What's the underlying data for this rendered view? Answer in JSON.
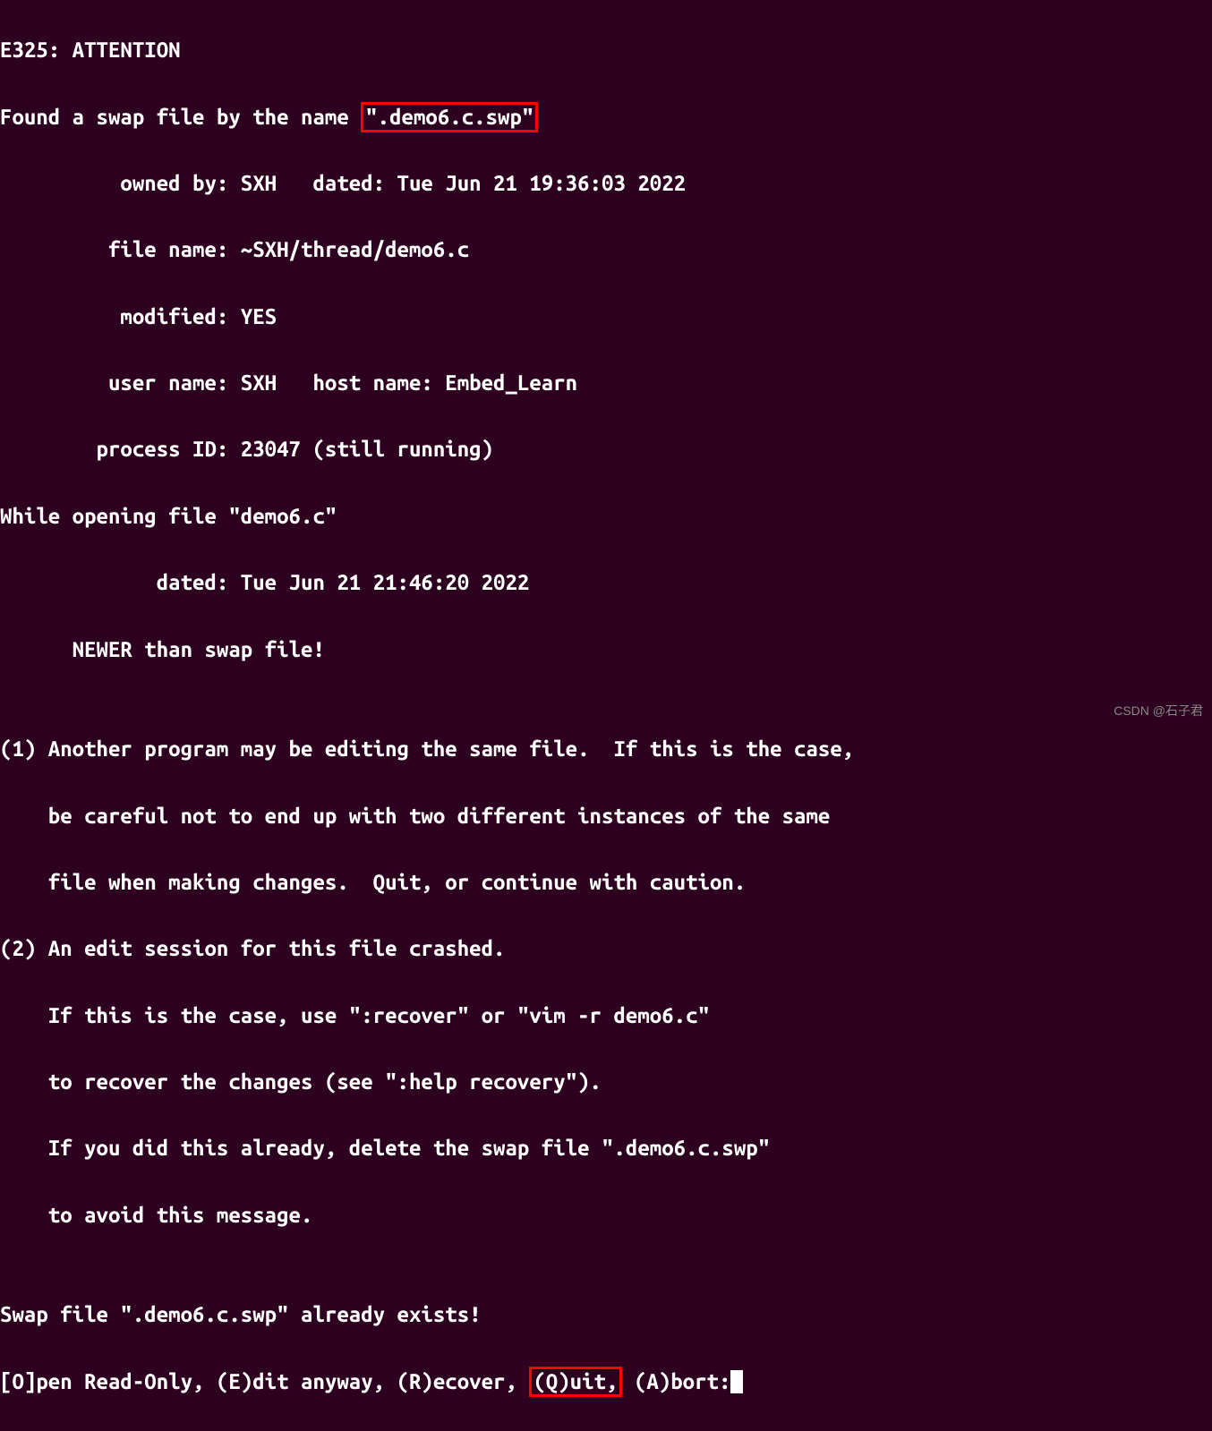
{
  "lines": {
    "l1": "E325: ATTENTION",
    "l2_pre": "Found a swap file by the name ",
    "l2_hl": "\".demo6.c.swp\"",
    "l3": "          owned by: SXH   dated: Tue Jun 21 19:36:03 2022",
    "l4": "         file name: ~SXH/thread/demo6.c",
    "l5": "          modified: YES",
    "l6": "         user name: SXH   host name: Embed_Learn",
    "l7": "        process ID: 23047 (still running)",
    "l8": "While opening file \"demo6.c\"",
    "l9": "             dated: Tue Jun 21 21:46:20 2022",
    "l10": "      NEWER than swap file!",
    "l11": "",
    "l12": "(1) Another program may be editing the same file.  If this is the case,",
    "l13": "    be careful not to end up with two different instances of the same",
    "l14": "    file when making changes.  Quit, or continue with caution.",
    "l15": "(2) An edit session for this file crashed.",
    "l16": "    If this is the case, use \":recover\" or \"vim -r demo6.c\"",
    "l17": "    to recover the changes (see \":help recovery\").",
    "l18": "    If you did this already, delete the swap file \".demo6.c.swp\"",
    "l19": "    to avoid this message.",
    "l20": "",
    "l21": "Swap file \".demo6.c.swp\" already exists!",
    "l22_pre": "[O]pen Read-Only, (E)dit anyway, (R)ecover, ",
    "l22_hl": "(Q)uit,",
    "l22_post": " (A)bort:"
  },
  "watermark": "CSDN @石子君"
}
